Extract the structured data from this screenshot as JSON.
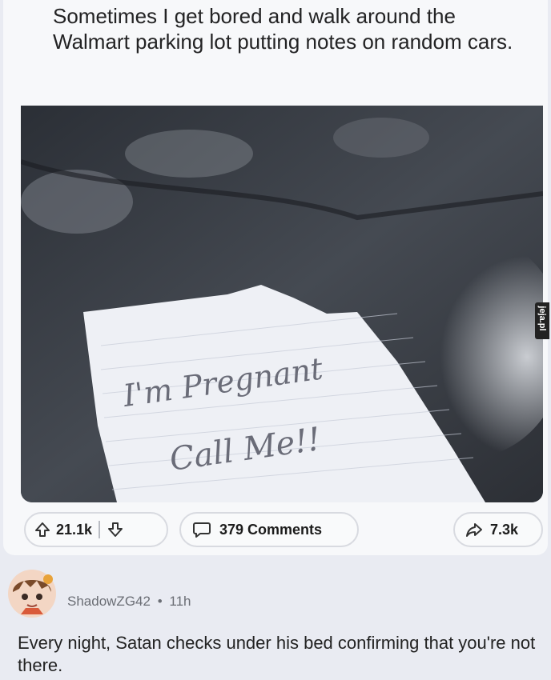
{
  "post": {
    "title": "Sometimes I get bored and walk around the Walmart parking lot putting notes on random cars.",
    "image": {
      "note_line1": "I'm Pregnant",
      "note_line2": "Call Me!!"
    },
    "actions": {
      "upvote_icon": "arrow-up-icon",
      "downvote_icon": "arrow-down-icon",
      "comment_icon": "speech-bubble-icon",
      "share_icon": "share-arrow-icon",
      "vote_count": "21.1k",
      "comments_label": "379 Comments",
      "share_count": "7.3k"
    }
  },
  "comment": {
    "username": "ShadowZG42",
    "separator": "•",
    "age": "11h",
    "body": "Every night, Satan checks under his bed confirming that you're not there."
  },
  "watermark": {
    "text": "jeja.pl"
  }
}
